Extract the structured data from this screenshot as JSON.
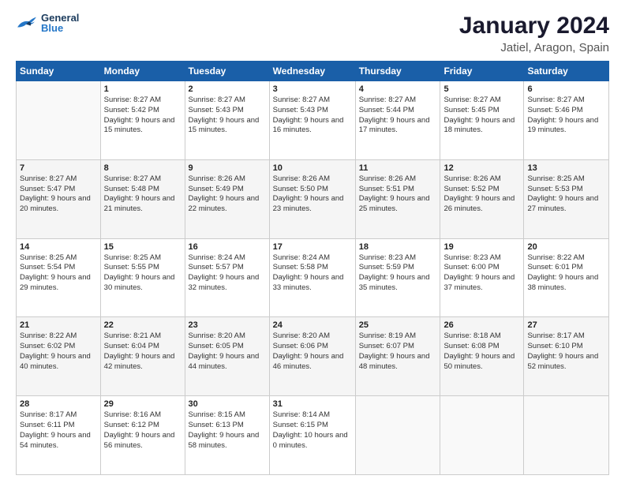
{
  "logo": {
    "general": "General",
    "blue": "Blue"
  },
  "header": {
    "title": "January 2024",
    "subtitle": "Jatiel, Aragon, Spain"
  },
  "weekdays": [
    "Sunday",
    "Monday",
    "Tuesday",
    "Wednesday",
    "Thursday",
    "Friday",
    "Saturday"
  ],
  "weeks": [
    [
      {
        "day": "",
        "sunrise": "",
        "sunset": "",
        "daylight": ""
      },
      {
        "day": "1",
        "sunrise": "Sunrise: 8:27 AM",
        "sunset": "Sunset: 5:42 PM",
        "daylight": "Daylight: 9 hours and 15 minutes."
      },
      {
        "day": "2",
        "sunrise": "Sunrise: 8:27 AM",
        "sunset": "Sunset: 5:43 PM",
        "daylight": "Daylight: 9 hours and 15 minutes."
      },
      {
        "day": "3",
        "sunrise": "Sunrise: 8:27 AM",
        "sunset": "Sunset: 5:43 PM",
        "daylight": "Daylight: 9 hours and 16 minutes."
      },
      {
        "day": "4",
        "sunrise": "Sunrise: 8:27 AM",
        "sunset": "Sunset: 5:44 PM",
        "daylight": "Daylight: 9 hours and 17 minutes."
      },
      {
        "day": "5",
        "sunrise": "Sunrise: 8:27 AM",
        "sunset": "Sunset: 5:45 PM",
        "daylight": "Daylight: 9 hours and 18 minutes."
      },
      {
        "day": "6",
        "sunrise": "Sunrise: 8:27 AM",
        "sunset": "Sunset: 5:46 PM",
        "daylight": "Daylight: 9 hours and 19 minutes."
      }
    ],
    [
      {
        "day": "7",
        "sunrise": "Sunrise: 8:27 AM",
        "sunset": "Sunset: 5:47 PM",
        "daylight": "Daylight: 9 hours and 20 minutes."
      },
      {
        "day": "8",
        "sunrise": "Sunrise: 8:27 AM",
        "sunset": "Sunset: 5:48 PM",
        "daylight": "Daylight: 9 hours and 21 minutes."
      },
      {
        "day": "9",
        "sunrise": "Sunrise: 8:26 AM",
        "sunset": "Sunset: 5:49 PM",
        "daylight": "Daylight: 9 hours and 22 minutes."
      },
      {
        "day": "10",
        "sunrise": "Sunrise: 8:26 AM",
        "sunset": "Sunset: 5:50 PM",
        "daylight": "Daylight: 9 hours and 23 minutes."
      },
      {
        "day": "11",
        "sunrise": "Sunrise: 8:26 AM",
        "sunset": "Sunset: 5:51 PM",
        "daylight": "Daylight: 9 hours and 25 minutes."
      },
      {
        "day": "12",
        "sunrise": "Sunrise: 8:26 AM",
        "sunset": "Sunset: 5:52 PM",
        "daylight": "Daylight: 9 hours and 26 minutes."
      },
      {
        "day": "13",
        "sunrise": "Sunrise: 8:25 AM",
        "sunset": "Sunset: 5:53 PM",
        "daylight": "Daylight: 9 hours and 27 minutes."
      }
    ],
    [
      {
        "day": "14",
        "sunrise": "Sunrise: 8:25 AM",
        "sunset": "Sunset: 5:54 PM",
        "daylight": "Daylight: 9 hours and 29 minutes."
      },
      {
        "day": "15",
        "sunrise": "Sunrise: 8:25 AM",
        "sunset": "Sunset: 5:55 PM",
        "daylight": "Daylight: 9 hours and 30 minutes."
      },
      {
        "day": "16",
        "sunrise": "Sunrise: 8:24 AM",
        "sunset": "Sunset: 5:57 PM",
        "daylight": "Daylight: 9 hours and 32 minutes."
      },
      {
        "day": "17",
        "sunrise": "Sunrise: 8:24 AM",
        "sunset": "Sunset: 5:58 PM",
        "daylight": "Daylight: 9 hours and 33 minutes."
      },
      {
        "day": "18",
        "sunrise": "Sunrise: 8:23 AM",
        "sunset": "Sunset: 5:59 PM",
        "daylight": "Daylight: 9 hours and 35 minutes."
      },
      {
        "day": "19",
        "sunrise": "Sunrise: 8:23 AM",
        "sunset": "Sunset: 6:00 PM",
        "daylight": "Daylight: 9 hours and 37 minutes."
      },
      {
        "day": "20",
        "sunrise": "Sunrise: 8:22 AM",
        "sunset": "Sunset: 6:01 PM",
        "daylight": "Daylight: 9 hours and 38 minutes."
      }
    ],
    [
      {
        "day": "21",
        "sunrise": "Sunrise: 8:22 AM",
        "sunset": "Sunset: 6:02 PM",
        "daylight": "Daylight: 9 hours and 40 minutes."
      },
      {
        "day": "22",
        "sunrise": "Sunrise: 8:21 AM",
        "sunset": "Sunset: 6:04 PM",
        "daylight": "Daylight: 9 hours and 42 minutes."
      },
      {
        "day": "23",
        "sunrise": "Sunrise: 8:20 AM",
        "sunset": "Sunset: 6:05 PM",
        "daylight": "Daylight: 9 hours and 44 minutes."
      },
      {
        "day": "24",
        "sunrise": "Sunrise: 8:20 AM",
        "sunset": "Sunset: 6:06 PM",
        "daylight": "Daylight: 9 hours and 46 minutes."
      },
      {
        "day": "25",
        "sunrise": "Sunrise: 8:19 AM",
        "sunset": "Sunset: 6:07 PM",
        "daylight": "Daylight: 9 hours and 48 minutes."
      },
      {
        "day": "26",
        "sunrise": "Sunrise: 8:18 AM",
        "sunset": "Sunset: 6:08 PM",
        "daylight": "Daylight: 9 hours and 50 minutes."
      },
      {
        "day": "27",
        "sunrise": "Sunrise: 8:17 AM",
        "sunset": "Sunset: 6:10 PM",
        "daylight": "Daylight: 9 hours and 52 minutes."
      }
    ],
    [
      {
        "day": "28",
        "sunrise": "Sunrise: 8:17 AM",
        "sunset": "Sunset: 6:11 PM",
        "daylight": "Daylight: 9 hours and 54 minutes."
      },
      {
        "day": "29",
        "sunrise": "Sunrise: 8:16 AM",
        "sunset": "Sunset: 6:12 PM",
        "daylight": "Daylight: 9 hours and 56 minutes."
      },
      {
        "day": "30",
        "sunrise": "Sunrise: 8:15 AM",
        "sunset": "Sunset: 6:13 PM",
        "daylight": "Daylight: 9 hours and 58 minutes."
      },
      {
        "day": "31",
        "sunrise": "Sunrise: 8:14 AM",
        "sunset": "Sunset: 6:15 PM",
        "daylight": "Daylight: 10 hours and 0 minutes."
      },
      {
        "day": "",
        "sunrise": "",
        "sunset": "",
        "daylight": ""
      },
      {
        "day": "",
        "sunrise": "",
        "sunset": "",
        "daylight": ""
      },
      {
        "day": "",
        "sunrise": "",
        "sunset": "",
        "daylight": ""
      }
    ]
  ]
}
